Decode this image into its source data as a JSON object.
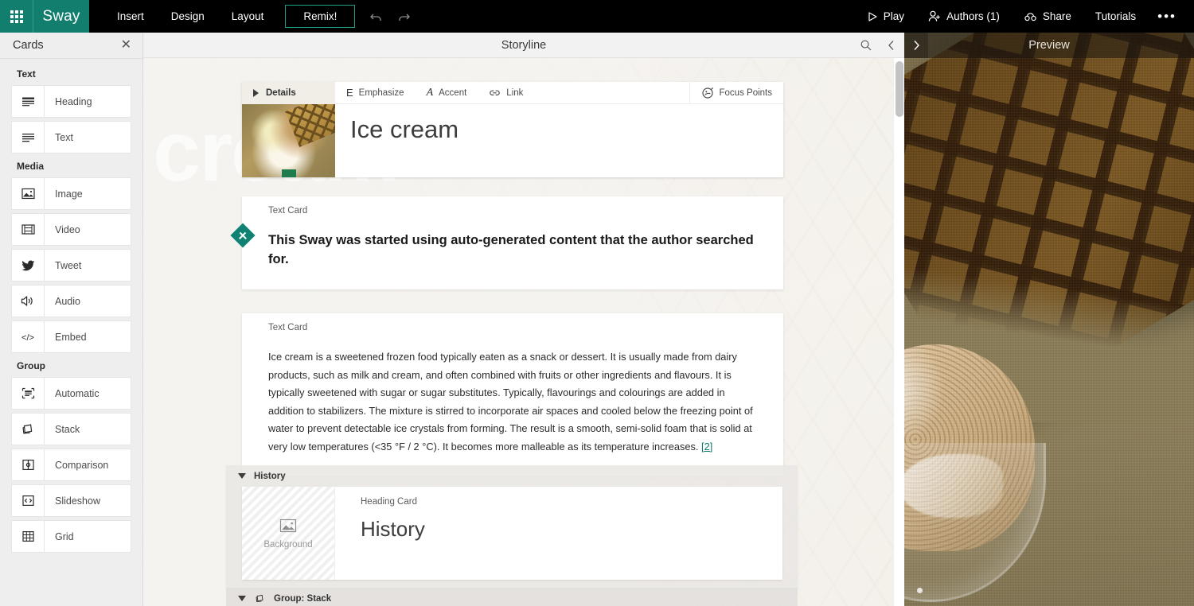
{
  "topbar": {
    "app_launcher": "app-launcher",
    "brand": "Sway",
    "menu": [
      {
        "label": "Insert"
      },
      {
        "label": "Design"
      },
      {
        "label": "Layout"
      }
    ],
    "remix_label": "Remix!",
    "undo_label": "undo",
    "redo_label": "redo",
    "right": [
      {
        "label": "Play",
        "icon": "play-icon"
      },
      {
        "label": "Authors (1)",
        "icon": "authors-icon"
      },
      {
        "label": "Share",
        "icon": "share-icon"
      },
      {
        "label": "Tutorials",
        "icon": "tutorials"
      }
    ],
    "overflow": "•••",
    "accent_color": "#127e6d",
    "background_color": "#000000"
  },
  "cards_panel": {
    "title": "Cards",
    "close_icon": "✕",
    "groups": [
      {
        "label": "Text",
        "items": [
          {
            "label": "Heading",
            "icon": "heading-icon"
          },
          {
            "label": "Text",
            "icon": "text-icon"
          }
        ]
      },
      {
        "label": "Media",
        "items": [
          {
            "label": "Image",
            "icon": "image-icon"
          },
          {
            "label": "Video",
            "icon": "video-icon"
          },
          {
            "label": "Tweet",
            "icon": "tweet-icon"
          },
          {
            "label": "Audio",
            "icon": "audio-icon"
          },
          {
            "label": "Embed",
            "icon": "embed-icon"
          }
        ]
      },
      {
        "label": "Group",
        "items": [
          {
            "label": "Automatic",
            "icon": "automatic-icon"
          },
          {
            "label": "Stack",
            "icon": "stack-icon"
          },
          {
            "label": "Comparison",
            "icon": "comparison-icon"
          },
          {
            "label": "Slideshow",
            "icon": "slideshow-icon"
          },
          {
            "label": "Grid",
            "icon": "grid-icon"
          }
        ]
      }
    ]
  },
  "storyline": {
    "header_title": "Storyline",
    "search_icon": "search-icon",
    "prev_icon": "chevron-left-icon",
    "next_icon": "chevron-right-icon",
    "watermark": "cream",
    "title_card": {
      "details_label": "Details",
      "toolbar": [
        {
          "label": "Emphasize",
          "glyph": "E"
        },
        {
          "label": "Accent",
          "glyph": "A"
        },
        {
          "label": "Link",
          "glyph": "link-icon"
        }
      ],
      "focus_points_label": "Focus Points",
      "title": "Ice cream"
    },
    "add_card_button": "add-card",
    "text_cards": [
      {
        "kind": "Text Card",
        "body": "This Sway was started using auto-generated content that the author searched for."
      },
      {
        "kind": "Text Card",
        "body": "Ice cream is a sweetened frozen food typically eaten as a snack or dessert. It is usually made from dairy products, such as milk and cream, and often combined with fruits or other ingredients and flavours. It is typically sweetened with sugar or sugar substitutes. Typically, flavourings and colourings are added in addition to stabilizers. The mixture is stirred to incorporate air spaces and cooled below the freezing point of water to prevent detectable ice crystals from forming. The result is a smooth, semi-solid foam that is solid at very low temperatures (<35 °F / 2 °C). It becomes more malleable as its temperature increases. ",
        "reference": "[2]"
      }
    ],
    "history_group": {
      "label": "History",
      "heading_card": {
        "kind": "Heading Card",
        "background_label": "Background",
        "background_icon": "image-icon",
        "title": "History"
      }
    },
    "stack_group": {
      "label": "Group: Stack",
      "icon": "stack-icon"
    }
  },
  "preview": {
    "title": "Preview"
  }
}
